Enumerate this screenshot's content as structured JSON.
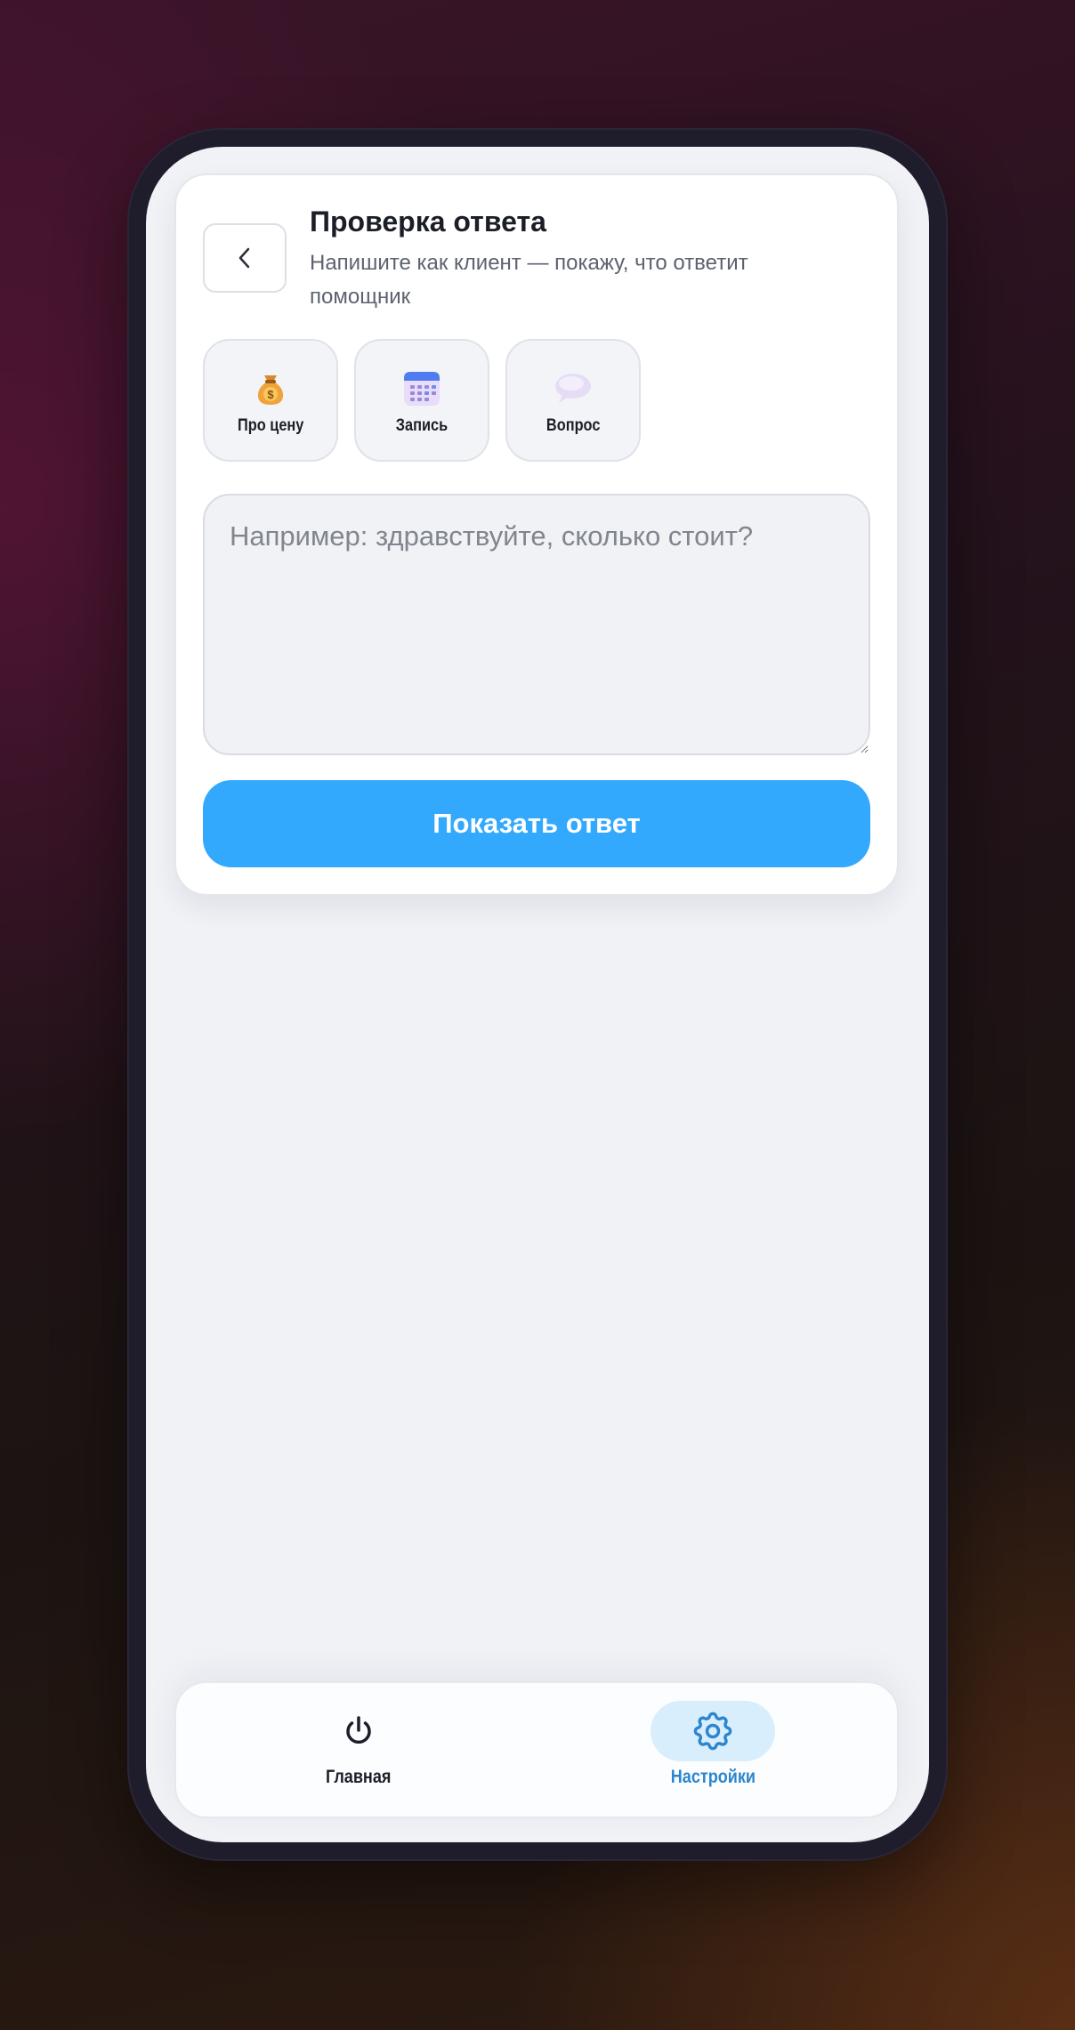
{
  "header": {
    "title": "Проверка ответа",
    "subtitle": "Напишите как клиент — покажу, что ответит помощник"
  },
  "quick_prompts": [
    {
      "label": "Про цену",
      "icon": "money-bag-icon"
    },
    {
      "label": "Запись",
      "icon": "calendar-icon"
    },
    {
      "label": "Вопрос",
      "icon": "speech-bubble-icon"
    }
  ],
  "message": {
    "value": "",
    "placeholder": "Например: здравствуйте, сколько стоит?"
  },
  "submit_label": "Показать ответ",
  "bottom_nav": {
    "items": [
      {
        "label": "Главная",
        "icon": "power-icon",
        "active": false
      },
      {
        "label": "Настройки",
        "icon": "gear-icon",
        "active": true
      }
    ]
  },
  "colors": {
    "accent": "#33a9fd",
    "active_nav": "#2b86cf",
    "active_nav_bg": "#d9eefc",
    "text": "#1b1e28"
  }
}
